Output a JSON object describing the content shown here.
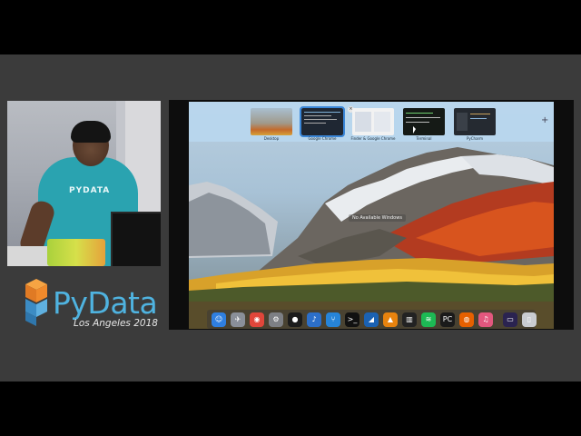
{
  "branding": {
    "name": "PyData",
    "subtitle": "Los Angeles 2018",
    "shirt_text": "PYDATA",
    "colors": {
      "accent": "#4fb3e0",
      "logo_orange": "#f08a2c",
      "logo_blue": "#4fa0d2"
    }
  },
  "mission_control": {
    "spaces": [
      {
        "label": "Desktop",
        "icon": "wallpaper-thumbnail"
      },
      {
        "label": "Google Chrome",
        "icon": "chrome-window-thumbnail"
      },
      {
        "label": "Finder & Google Chrome",
        "icon": "finder-chrome-thumbnail"
      },
      {
        "label": "Terminal",
        "icon": "terminal-thumbnail"
      },
      {
        "label": "PyCharm",
        "icon": "pycharm-thumbnail"
      }
    ],
    "add_label": "+",
    "close_label": "×"
  },
  "desktop": {
    "window_label": "No Available Windows"
  },
  "dock": {
    "apps": [
      {
        "name": "finder",
        "glyph": "☺",
        "color": "#2f7fe0"
      },
      {
        "name": "launchpad",
        "glyph": "✈",
        "color": "#8a8f99"
      },
      {
        "name": "chrome",
        "glyph": "◉",
        "color": "#e0463a"
      },
      {
        "name": "system-preferences",
        "glyph": "⚙",
        "color": "#7d7f84"
      },
      {
        "name": "music-app",
        "glyph": "●",
        "color": "#1b1b1b"
      },
      {
        "name": "audio-app",
        "glyph": "♪",
        "color": "#2c6fc9"
      },
      {
        "name": "sourcetree",
        "glyph": "⑂",
        "color": "#2684d8"
      },
      {
        "name": "terminal",
        "glyph": ">_",
        "color": "#111111"
      },
      {
        "name": "vscode",
        "glyph": "◢",
        "color": "#1b62b3"
      },
      {
        "name": "vlc",
        "glyph": "▲",
        "color": "#e8830e"
      },
      {
        "name": "activity-monitor",
        "glyph": "▥",
        "color": "#222222"
      },
      {
        "name": "spotify",
        "glyph": "≋",
        "color": "#1db954"
      },
      {
        "name": "pycharm",
        "glyph": "PC",
        "color": "#1a1a1a"
      },
      {
        "name": "firefox",
        "glyph": "◍",
        "color": "#e66000"
      },
      {
        "name": "itunes",
        "glyph": "♫",
        "color": "#e2577e"
      },
      {
        "name": "screen-app",
        "glyph": "▭",
        "color": "#2a2350"
      },
      {
        "name": "trash",
        "glyph": "▯",
        "color": "#c9ccd1"
      }
    ]
  }
}
